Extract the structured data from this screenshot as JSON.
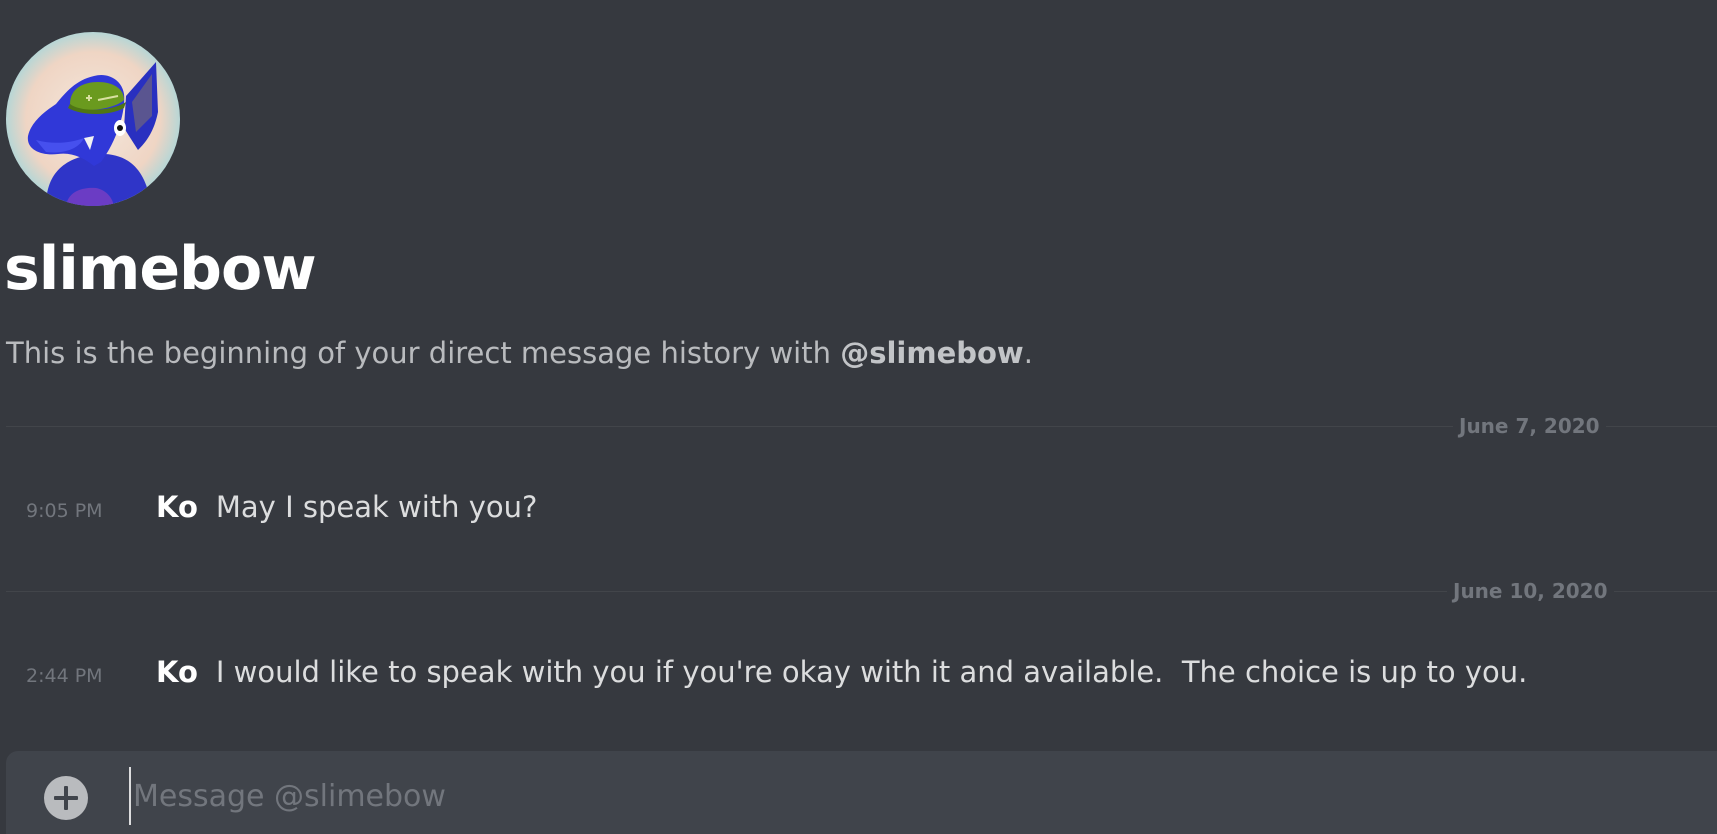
{
  "channel": {
    "avatar_icon": "user-avatar-blue-dragon-green-helmet",
    "username": "slimebow",
    "intro_prefix": "This is the beginning of your direct message history with ",
    "intro_mention": "@slimebow",
    "intro_suffix": "."
  },
  "days": [
    {
      "date": "June 7, 2020",
      "messages": [
        {
          "time": "9:05 PM",
          "author": "Ko",
          "text": "May I speak with you?"
        }
      ]
    },
    {
      "date": "June 10, 2020",
      "messages": [
        {
          "time": "2:44 PM",
          "author": "Ko",
          "text": "I would like to speak with you if you're okay with it and available.  The choice is up to you."
        }
      ]
    }
  ],
  "composer": {
    "attach_icon": "plus-circle-icon",
    "placeholder": "Message @slimebow",
    "value": ""
  },
  "colors": {
    "background": "#36393f",
    "composer_background": "#40444b",
    "divider": "#42454a",
    "muted_text": "#72767d",
    "primary_text": "#dcddde",
    "heading_text": "#ffffff"
  }
}
